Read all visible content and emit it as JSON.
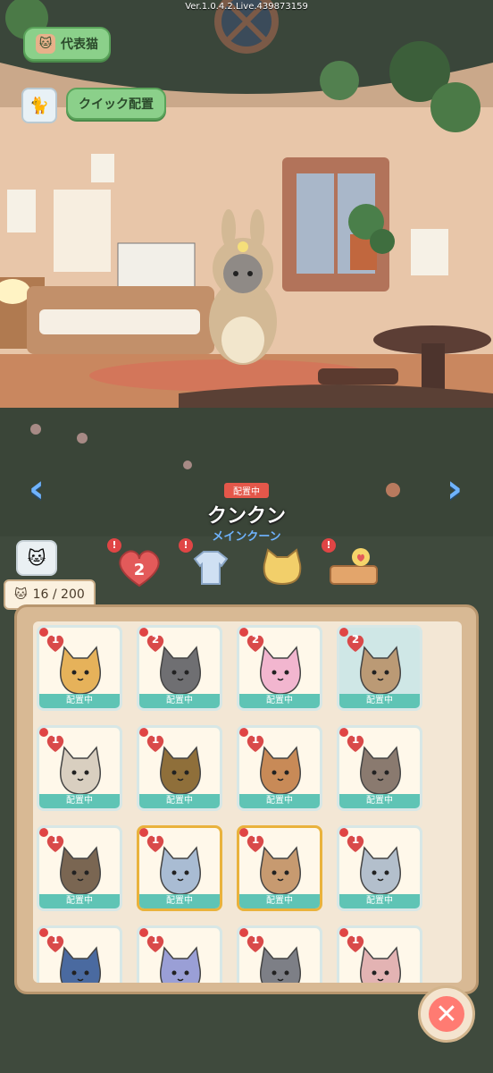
{
  "version": "Ver.1.0.4.2.Live.439873159",
  "top_buttons": {
    "representative_cat": "代表猫",
    "quick_deploy": "クイック配置"
  },
  "selected_cat": {
    "status": "配置中",
    "name": "クンクン",
    "breed": "メインクーン",
    "level": "2"
  },
  "cat_count": "16 / 200",
  "cards": [
    {
      "level": "1",
      "label": "配置中",
      "color": "#e6b25a"
    },
    {
      "level": "2",
      "label": "配置中",
      "color": "#6f6f72"
    },
    {
      "level": "2",
      "label": "配置中",
      "color": "#f2b6cf"
    },
    {
      "level": "2",
      "label": "配置中",
      "color": "#bb9a75"
    },
    {
      "level": "1",
      "label": "配置中",
      "color": "#d9cfc0"
    },
    {
      "level": "1",
      "label": "配置中",
      "color": "#8f6f3a"
    },
    {
      "level": "1",
      "label": "配置中",
      "color": "#c88a57"
    },
    {
      "level": "1",
      "label": "配置中",
      "color": "#8a7a6f"
    },
    {
      "level": "1",
      "label": "配置中",
      "color": "#7a6652"
    },
    {
      "level": "1",
      "label": "配置中",
      "color": "#a9bcd3"
    },
    {
      "level": "1",
      "label": "配置中",
      "color": "#c79a70"
    },
    {
      "level": "1",
      "label": "配置中",
      "color": "#b3bfcc"
    },
    {
      "level": "1",
      "label": "",
      "color": "#4a6aa0"
    },
    {
      "level": "1",
      "label": "",
      "color": "#9a9fd6"
    },
    {
      "level": "1",
      "label": "",
      "color": "#7d7f86"
    },
    {
      "level": "1",
      "label": "",
      "color": "#e3b3b3"
    }
  ]
}
